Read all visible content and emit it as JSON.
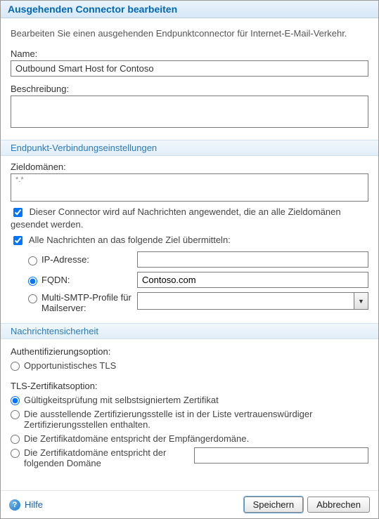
{
  "title": "Ausgehenden Connector bearbeiten",
  "intro": "Bearbeiten Sie einen ausgehenden Endpunktconnector für Internet-E-Mail-Verkehr.",
  "name_label": "Name:",
  "name_value": "Outbound Smart Host for Contoso",
  "description_label": "Beschreibung:",
  "description_value": "",
  "section_endpoint": "Endpunkt-Verbindungseinstellungen",
  "target_domains_label": "Zieldomänen:",
  "target_domains_value": "*.*",
  "apply_all_label": "Dieser Connector wird auf Nachrichten angewendet, die an alle Zieldomänen gesendet werden.",
  "apply_all_checked": true,
  "deliver_all_label": "Alle Nachrichten an das folgende Ziel übermitteln:",
  "deliver_all_checked": true,
  "dest_options": {
    "ip_label": "IP-Adresse:",
    "ip_value": "",
    "fqdn_label": "FQDN:",
    "fqdn_value": "Contoso.com",
    "multi_label": "Multi-SMTP-Profile für Mailserver:",
    "multi_value": "",
    "selected": "fqdn"
  },
  "section_security": "Nachrichtensicherheit",
  "auth_heading": "Authentifizierungsoption:",
  "auth_options": {
    "opportunistic_label": "Opportunistisches TLS",
    "selected": ""
  },
  "tls_heading": "TLS-Zertifikatsoption:",
  "tls_options": {
    "self_signed_label": "Gültigkeitsprüfung mit selbstsigniertem Zertifikat",
    "ca_list_label": "Die ausstellende Zertifizierungsstelle ist in der Liste vertrauenswürdiger Zertifizierungsstellen enthalten.",
    "match_recipient_label": "Die Zertifikatdomäne entspricht der Empfängerdomäne.",
    "match_domain_label": "Die Zertifikatdomäne entspricht der folgenden Domäne",
    "match_domain_value": "",
    "selected": "self_signed"
  },
  "help_label": "Hilfe",
  "save_label": "Speichern",
  "cancel_label": "Abbrechen"
}
